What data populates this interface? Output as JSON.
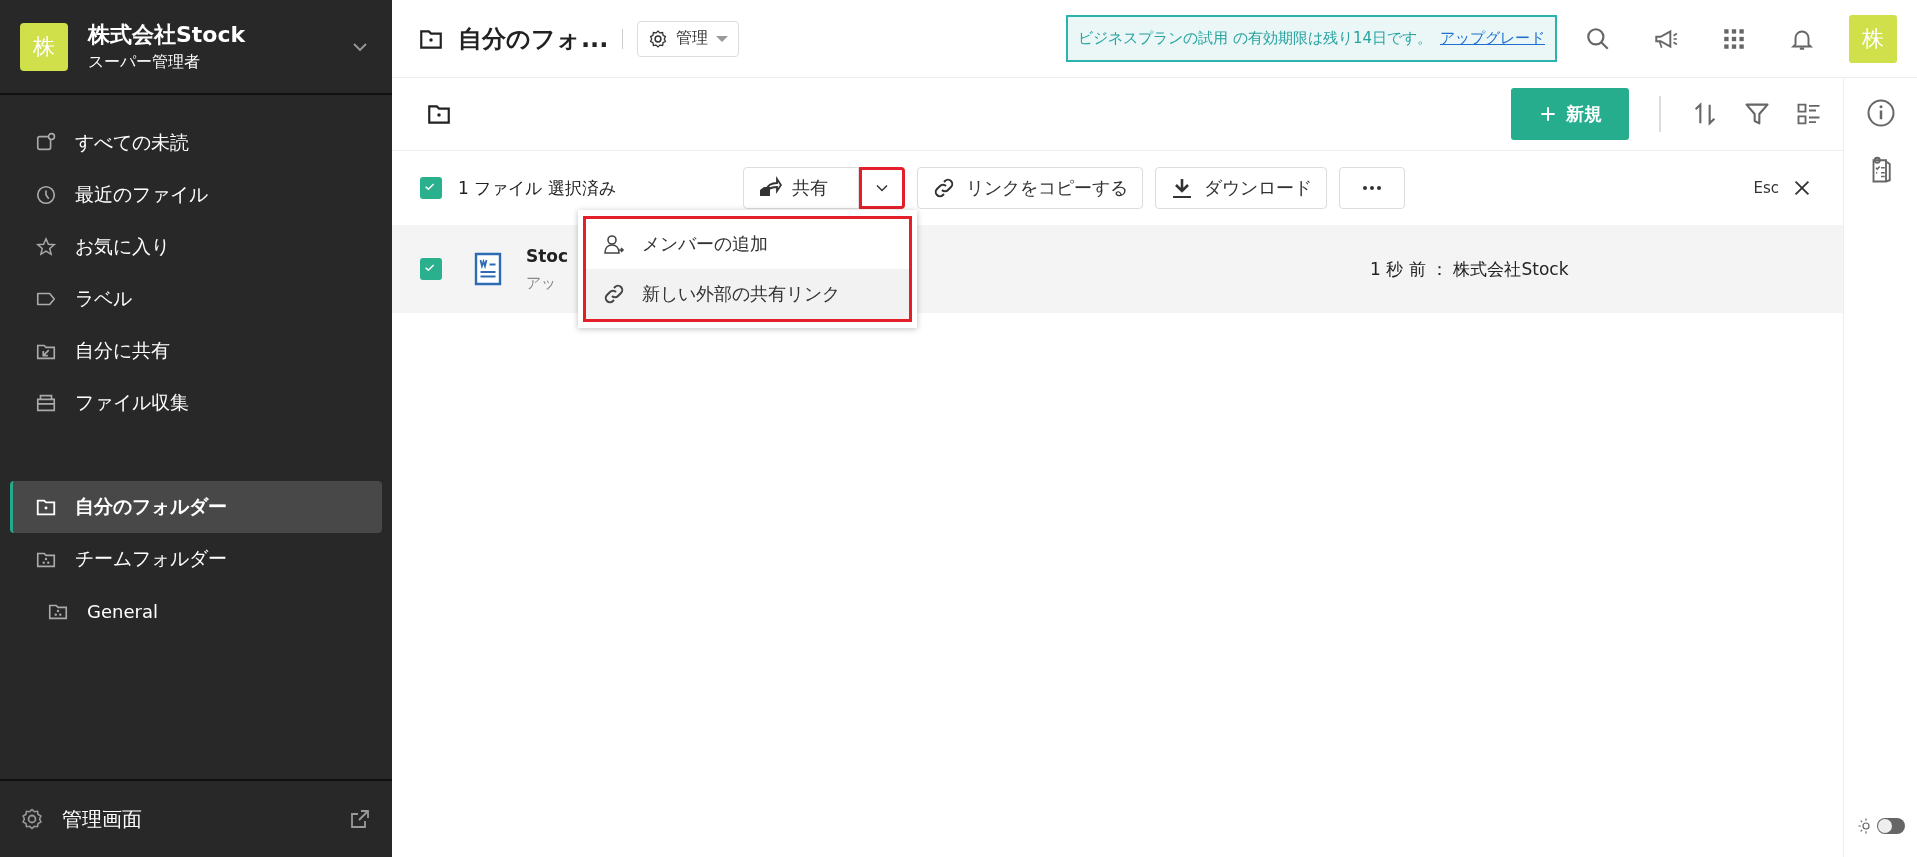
{
  "sidebar": {
    "org": {
      "avatar": "株",
      "name": "株式会社Stock",
      "role": "スーパー管理者"
    },
    "nav_items": [
      {
        "label": "すべての未読",
        "selected": false
      },
      {
        "label": "最近のファイル",
        "selected": false
      },
      {
        "label": "お気に入り",
        "selected": false
      },
      {
        "label": "ラベル",
        "selected": false
      },
      {
        "label": "自分に共有",
        "selected": false
      },
      {
        "label": "ファイル収集",
        "selected": false
      }
    ],
    "folders": [
      {
        "label": "自分のフォルダー",
        "selected": true
      },
      {
        "label": "チームフォルダー",
        "selected": false,
        "children": [
          {
            "label": "General",
            "selected": false
          }
        ]
      }
    ],
    "footer": {
      "label": "管理画面"
    }
  },
  "header": {
    "title": "自分のフォ...",
    "manage_button": "管理",
    "trial_banner": {
      "text": "ビジネスプランの試用 の有効期限は残り14日です。",
      "link": "アップグレード"
    },
    "avatar": "株"
  },
  "toolbar": {
    "new_button": "新規"
  },
  "selection_bar": {
    "checked": true,
    "count_text": "1 ファイル 選択済み",
    "share_button": "共有",
    "share_dropdown": {
      "highlighted": true
    },
    "copy_link_button": "リンクをコピーする",
    "download_button": "ダウンロード",
    "esc_label": "Esc"
  },
  "share_menu": {
    "highlighted": true,
    "items": [
      {
        "label": "メンバーの追加",
        "hovered": false
      },
      {
        "label": "新しい外部の共有リンク",
        "hovered": true
      }
    ]
  },
  "files": [
    {
      "name": "Stoc",
      "subtitle": "アッ",
      "modified": "1 秒 前 ： 株式会社Stock",
      "checked": true
    }
  ],
  "theme_toggle": {
    "on": false
  }
}
